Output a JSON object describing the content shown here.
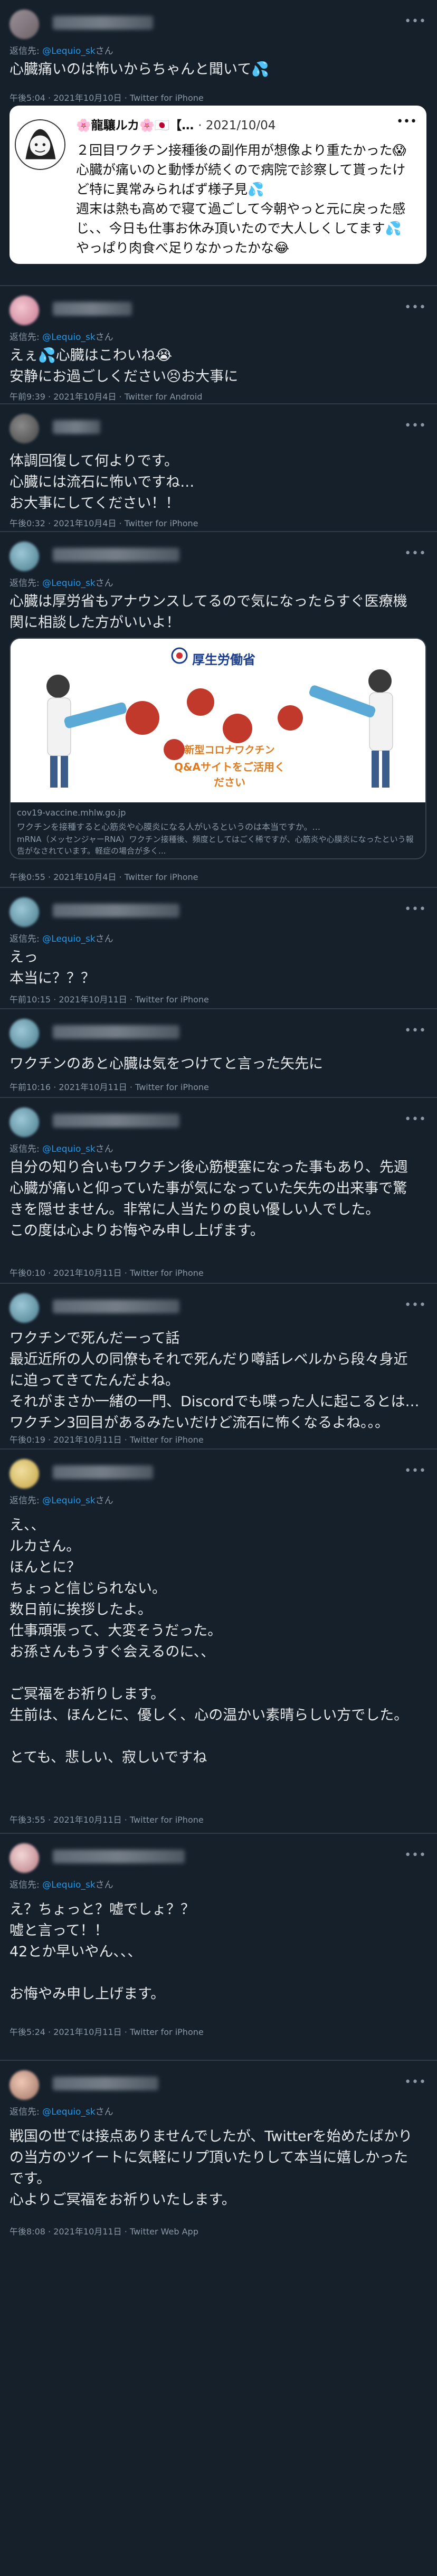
{
  "app": {
    "name": "Twitter thread"
  },
  "tweets": [
    {
      "reply_prefix": "返信先: ",
      "reply_handle": "@Lequio_sk",
      "reply_suffix": "さん",
      "text": "心臓痛いのは怖いからちゃんと聞いて💦",
      "time": "午後5:04 · 2021年10月10日",
      "source": "Twitter for iPhone",
      "quote": {
        "name": "🌸龍驤ルカ🌸🇯🇵【…",
        "date": "· 2021/10/04",
        "text": "２回目ワクチン接種後の副作用が想像より重たかった😱\n心臓が痛いのと動悸が続くので病院で診察して貰ったけど特に異常みらればず様子見💦\n週末は熱も高めで寝て過ごして今朝やっと元に戻った感じ、、今日も仕事お休み頂いたので大人しくしてます💦\nやっぱり肉食べ足りなかったかな😂"
      }
    },
    {
      "reply_prefix": "返信先: ",
      "reply_handle": "@Lequio_sk",
      "reply_suffix": "さん",
      "text": "えぇ💦心臓はこわいね😭\n安静にお過ごしください😣お大事に",
      "time": "午前9:39 · 2021年10月4日",
      "source": "Twitter for Android"
    },
    {
      "text": "体調回復して何よりです。\n心臓には流石に怖いですね…\nお大事にしてください！！",
      "time": "午後0:32 · 2021年10月4日",
      "source": "Twitter for iPhone"
    },
    {
      "reply_prefix": "返信先: ",
      "reply_handle": "@Lequio_sk",
      "reply_suffix": "さん",
      "text": "心臓は厚労省もアナウンスしてるので気になったらすぐ医療機関に相談した方がいいよ！",
      "card": {
        "logo_text": "厚生労働省",
        "banner_line1": "新型コロナワクチン",
        "banner_line2": "Q&Aサイトをご活用ください",
        "domain": "cov19-vaccine.mhlw.go.jp",
        "title": "ワクチンを接種すると心筋炎や心膜炎になる人がいるというのは本当ですか。...",
        "desc": "mRNA（メッセンジャーRNA）ワクチン接種後、頻度としてはごく稀ですが、心筋炎や心膜炎になったという報告がなされています。軽症の場合が多く..."
      },
      "time": "午後0:55 · 2021年10月4日",
      "source": "Twitter for iPhone"
    },
    {
      "reply_prefix": "返信先: ",
      "reply_handle": "@Lequio_sk",
      "reply_suffix": "さん",
      "text": "えっ\n本当に？？？",
      "time": "午前10:15 · 2021年10月11日",
      "source": "Twitter for iPhone"
    },
    {
      "text": "ワクチンのあと心臓は気をつけてと言った矢先に",
      "time": "午前10:16 · 2021年10月11日",
      "source": "Twitter for iPhone"
    },
    {
      "reply_prefix": "返信先: ",
      "reply_handle": "@Lequio_sk",
      "reply_suffix": "さん",
      "text": "自分の知り合いもワクチン後心筋梗塞になった事もあり、先週心臓が痛いと仰っていた事が気になっていた矢先の出来事で驚きを隠せません。非常に人当たりの良い優しい人でした。\nこの度は心よりお悔やみ申し上げます。",
      "time": "午後0:10 · 2021年10月11日",
      "source": "Twitter for iPhone"
    },
    {
      "text": "ワクチンで死んだーって話\n最近近所の人の同僚もそれで死んだり噂話レベルから段々身近に迫ってきてたんだよね。\nそれがまさか一緒の一門、Discordでも喋った人に起こるとは…ワクチン3回目があるみたいだけど流石に怖くなるよね。。。",
      "time": "午後0:19 · 2021年10月11日",
      "source": "Twitter for iPhone"
    },
    {
      "reply_prefix": "返信先: ",
      "reply_handle": "@Lequio_sk",
      "reply_suffix": "さん",
      "text": "え、、\nルカさん。\nほんとに？\nちょっと信じられない。\n数日前に挨拶したよ。\n仕事頑張って、大変そうだった。\nお孫さんもうすぐ会えるのに、、\n\nご冥福をお祈りします。\n生前は、ほんとに、優しく、心の温かい素晴らしい方でした。\n\nとても、悲しい、寂しいですね",
      "time": "午後3:55 · 2021年10月11日",
      "source": "Twitter for iPhone"
    },
    {
      "reply_prefix": "返信先: ",
      "reply_handle": "@Lequio_sk",
      "reply_suffix": "さん",
      "text": "え？ちょっと？嘘でしょ？？\n嘘と言って！！\n42とか早いやん、、、\n\nお悔やみ申し上げます。",
      "time": "午後5:24 · 2021年10月11日",
      "source": "Twitter for iPhone"
    },
    {
      "reply_prefix": "返信先: ",
      "reply_handle": "@Lequio_sk",
      "reply_suffix": "さん",
      "text": "戦国の世では接点ありませんでしたが、Twitterを始めたばかりの当方のツイートに気軽にリプ頂いたりして本当に嬉しかったです。\n心よりご冥福をお祈りいたします。",
      "time": "午後8:08 · 2021年10月11日",
      "source": "Twitter Web App"
    }
  ]
}
